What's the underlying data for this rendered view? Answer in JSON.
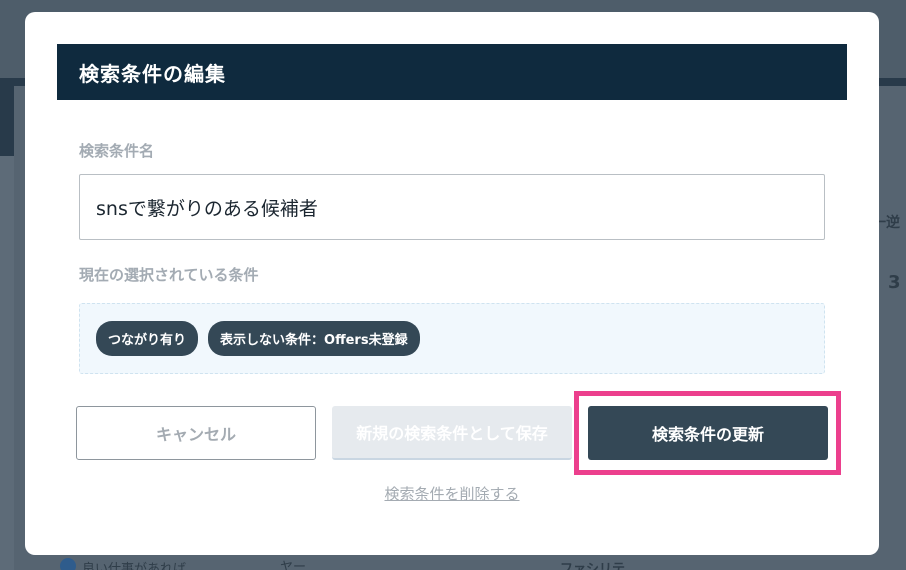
{
  "background": {
    "right_edge_text_1": "一逆",
    "right_edge_text_2": "3",
    "bottom_text_left": "良い仕事があれば",
    "bottom_text_mid": "ヤー",
    "bottom_text_right": "ファシリテ"
  },
  "modal": {
    "title": "検索条件の編集",
    "name_field": {
      "label": "検索条件名",
      "value": "snsで繋がりのある候補者"
    },
    "conditions": {
      "label": "現在の選択されている条件",
      "chips": [
        "つながり有り",
        "表示しない条件：Offers未登録"
      ]
    },
    "buttons": {
      "cancel": "キャンセル",
      "save_as_new": "新規の検索条件として保存",
      "update": "検索条件の更新"
    },
    "delete_link": "検索条件を削除する"
  },
  "colors": {
    "header_bg": "#0f2a3e",
    "primary_button": "#344856",
    "highlight_border": "#ec3f8d",
    "chip_bg": "#344856"
  }
}
